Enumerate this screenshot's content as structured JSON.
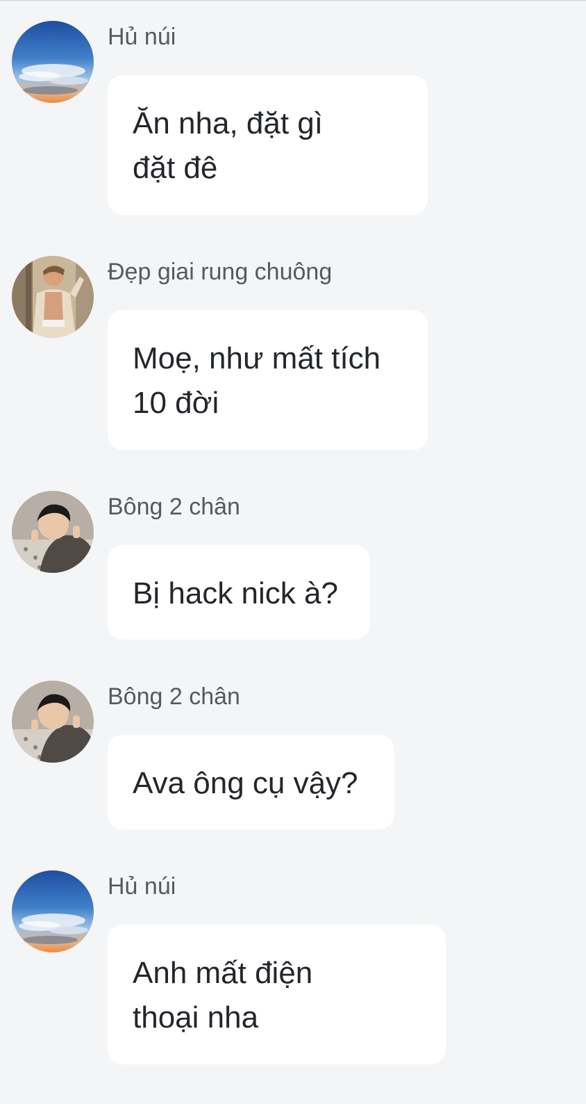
{
  "messages": [
    {
      "sender": "Hủ núi",
      "avatar": "sky-avatar-icon",
      "text": "Ăn nha, đặt gì\nđặt đê"
    },
    {
      "sender": "Đẹp giai rung chuông",
      "avatar": "man-portrait-avatar-icon",
      "text": "Moẹ, như mất tích\n10 đời"
    },
    {
      "sender": "Bông 2 chân",
      "avatar": "boy-selfie-avatar-icon",
      "text": "Bị hack nick à?"
    },
    {
      "sender": "Bông 2 chân",
      "avatar": "boy-selfie-avatar-icon",
      "text": "Ava ông cụ vậy?"
    },
    {
      "sender": "Hủ núi",
      "avatar": "sky-avatar-icon",
      "text": "Anh mất điện\nthoại nha"
    }
  ],
  "colors": {
    "background": "#f4f5f7",
    "bubble": "#ffffff",
    "sender_text": "#555a61",
    "message_text": "#23262b"
  }
}
